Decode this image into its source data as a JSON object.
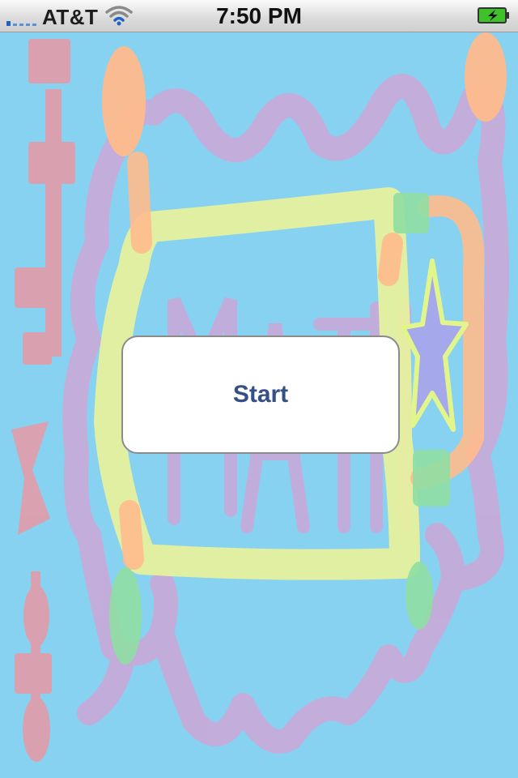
{
  "status_bar": {
    "carrier": "AT&T",
    "time": "7:50 PM",
    "signal_bars": 1,
    "wifi_icon": "wifi-icon",
    "battery_icon": "battery-charging-icon",
    "battery_color": "#3fc12a"
  },
  "canvas": {
    "background_color": "#87d2f1",
    "stroke_colors": {
      "purple": "#c8a9d9",
      "yellow": "#e6f09e",
      "orange": "#ffbb8c",
      "pink": "#f5919a",
      "green": "#90dea2",
      "star_fill": "#a6a8ec",
      "star_outline": "#e2f58a"
    }
  },
  "main": {
    "start_label": "Start"
  }
}
